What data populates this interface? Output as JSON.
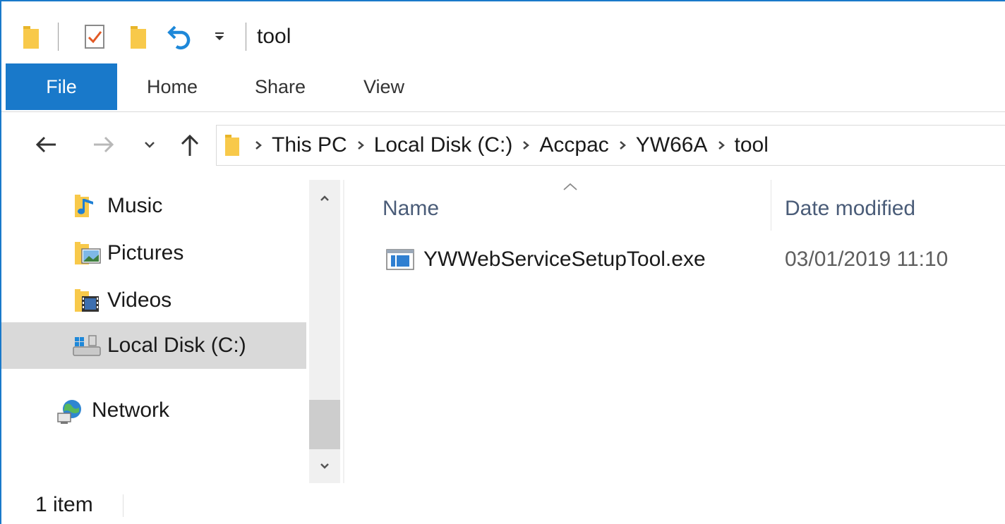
{
  "window": {
    "title": "tool"
  },
  "colors": {
    "accent": "#1979ca",
    "selected_bg": "#d9d9d9",
    "folder_yellow": "#f8c94a",
    "column_header_text": "#4a5c78"
  },
  "quick_access": {
    "icons": [
      "folder-icon",
      "properties-icon",
      "new-folder-icon",
      "undo-icon",
      "customize-dropdown-icon"
    ]
  },
  "ribbon": {
    "tabs": [
      {
        "label": "File",
        "active": true
      },
      {
        "label": "Home"
      },
      {
        "label": "Share"
      },
      {
        "label": "View"
      }
    ]
  },
  "navigation": {
    "back_icon": "back-arrow-icon",
    "forward_icon": "forward-arrow-icon",
    "recent_icon": "chevron-down-icon",
    "up_icon": "up-arrow-icon",
    "breadcrumb": [
      "This PC",
      "Local Disk (C:)",
      "Accpac",
      "YW66A",
      "tool"
    ]
  },
  "nav_pane": {
    "items": [
      {
        "label": "Music",
        "icon": "music-folder-icon"
      },
      {
        "label": "Pictures",
        "icon": "pictures-folder-icon"
      },
      {
        "label": "Videos",
        "icon": "videos-folder-icon"
      },
      {
        "label": "Local Disk (C:)",
        "icon": "local-disk-icon",
        "selected": true
      },
      {
        "label": "Network",
        "icon": "network-icon"
      }
    ]
  },
  "file_list": {
    "columns": [
      "Name",
      "Date modified"
    ],
    "sort_column": "Name",
    "rows": [
      {
        "name": "YWWebServiceSetupTool.exe",
        "date_modified": "03/01/2019 11:10",
        "icon": "exe-file-icon"
      }
    ]
  },
  "status": {
    "item_count": "1 item"
  }
}
